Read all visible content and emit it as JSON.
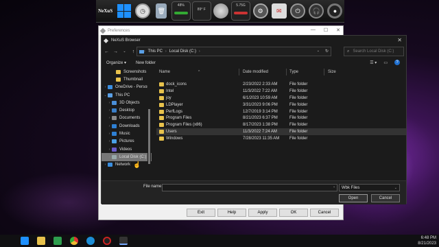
{
  "dock": {
    "logo": "NeXuS",
    "gauge1": "48%",
    "gauge2": "89° F",
    "gauge3": "5.75G"
  },
  "preferences": {
    "title": "Preferences",
    "buttons": [
      "Exit",
      "Help",
      "Apply",
      "OK",
      "Cancel"
    ]
  },
  "dialog": {
    "title": "NeXuS Browser",
    "breadcrumb": [
      "This PC",
      "Local Disk (C:)"
    ],
    "search_placeholder": "Search Local Disk (C:)",
    "toolbar": {
      "organize": "Organize ▾",
      "new_folder": "New folder"
    },
    "tree": [
      {
        "label": "Screenshots",
        "chev": "",
        "color": "#e8c24c",
        "indent": 2,
        "selected": false
      },
      {
        "label": "Thumbnail",
        "chev": "",
        "color": "#e8c24c",
        "indent": 2,
        "selected": false
      },
      {
        "label": "OneDrive - Person",
        "chev": "›",
        "color": "#3b8fe0",
        "indent": 0,
        "selected": false
      },
      {
        "label": "This PC",
        "chev": "⌄",
        "color": "#5aa0e6",
        "indent": 0,
        "selected": false
      },
      {
        "label": "3D Objects",
        "chev": "›",
        "color": "#4a8fd9",
        "indent": 1,
        "selected": false
      },
      {
        "label": "Desktop",
        "chev": "›",
        "color": "#3a7fc9",
        "indent": 1,
        "selected": false
      },
      {
        "label": "Documents",
        "chev": "›",
        "color": "#8a8a8a",
        "indent": 1,
        "selected": false
      },
      {
        "label": "Downloads",
        "chev": "›",
        "color": "#2e80d4",
        "indent": 1,
        "selected": false
      },
      {
        "label": "Music",
        "chev": "›",
        "color": "#2e80d4",
        "indent": 1,
        "selected": false
      },
      {
        "label": "Pictures",
        "chev": "›",
        "color": "#4aa0e6",
        "indent": 1,
        "selected": false
      },
      {
        "label": "Videos",
        "chev": "›",
        "color": "#6a5ac9",
        "indent": 1,
        "selected": false
      },
      {
        "label": "Local Disk (C:)",
        "chev": "›",
        "color": "#9aa",
        "indent": 1,
        "selected": true
      },
      {
        "label": "Network",
        "chev": "›",
        "color": "#3b8fe0",
        "indent": 0,
        "selected": false
      }
    ],
    "columns": [
      "Name",
      "Date modified",
      "Type",
      "Size"
    ],
    "rows": [
      {
        "name": "dock_icons",
        "date": "2/23/2022 2:33 AM",
        "type": "File folder"
      },
      {
        "name": "Intel",
        "date": "11/3/2022 7:22 AM",
        "type": "File folder"
      },
      {
        "name": "joy",
        "date": "6/1/2023 10:59 AM",
        "type": "File folder"
      },
      {
        "name": "LDPlayer",
        "date": "3/31/2023 9:06 PM",
        "type": "File folder"
      },
      {
        "name": "PerfLogs",
        "date": "12/7/2019 3:14 PM",
        "type": "File folder"
      },
      {
        "name": "Program Files",
        "date": "8/21/2023 6:37 PM",
        "type": "File folder"
      },
      {
        "name": "Program Files (x86)",
        "date": "8/17/2023 1:38 PM",
        "type": "File folder"
      },
      {
        "name": "Users",
        "date": "11/3/2022 7:24 AM",
        "type": "File folder"
      },
      {
        "name": "Windows",
        "date": "7/28/2023 11:35 AM",
        "type": "File folder"
      }
    ],
    "filename_label": "File name:",
    "filename_value": "",
    "filetype": "Wbk Files",
    "open_label": "Open",
    "cancel_label": "Cancel"
  },
  "tray": {
    "time": "6:48 PM",
    "date": "8/21/2023"
  }
}
